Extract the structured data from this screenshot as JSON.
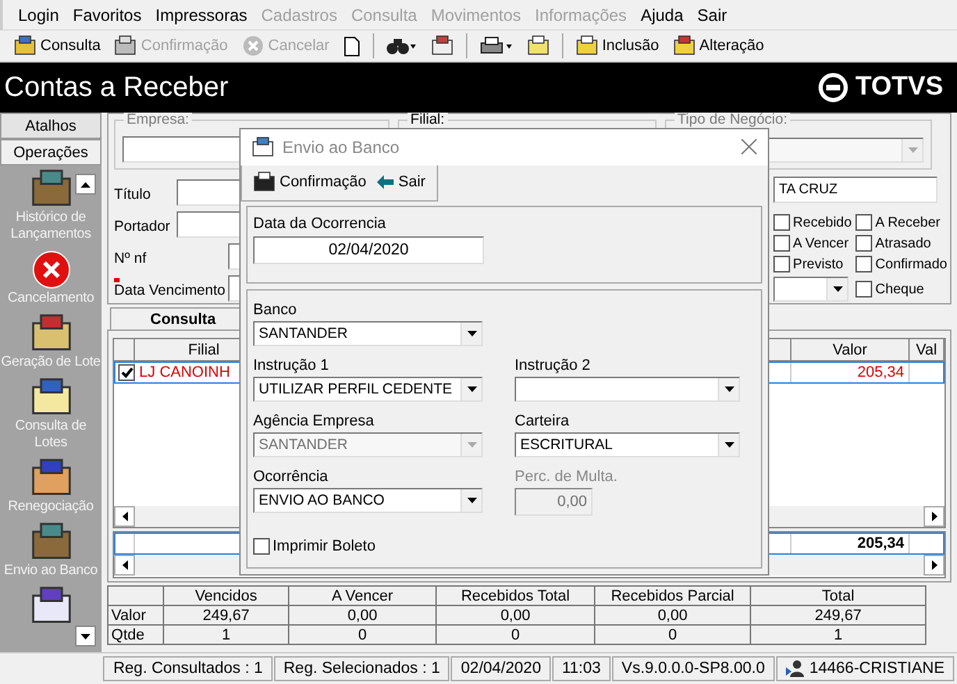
{
  "menu": [
    {
      "label": "Login",
      "disabled": false
    },
    {
      "label": "Favoritos",
      "disabled": false
    },
    {
      "label": "Impressoras",
      "disabled": false
    },
    {
      "label": "Cadastros",
      "disabled": true
    },
    {
      "label": "Consulta",
      "disabled": true
    },
    {
      "label": "Movimentos",
      "disabled": true
    },
    {
      "label": "Informações",
      "disabled": true
    },
    {
      "label": "Ajuda",
      "disabled": false
    },
    {
      "label": "Sair",
      "disabled": false
    }
  ],
  "toolbar": {
    "actions": [
      {
        "label": "Consulta",
        "disabled": false
      },
      {
        "label": "Confirmação",
        "disabled": true
      },
      {
        "label": "Cancelar",
        "disabled": true
      }
    ],
    "records": [
      {
        "label": "Inclusão",
        "disabled": false
      },
      {
        "label": "Alteração",
        "disabled": false
      }
    ]
  },
  "window": {
    "title": "Contas a Receber",
    "logo": "TOTVS"
  },
  "sidebar": {
    "tabs": [
      {
        "label": "Atalhos",
        "selected": false
      },
      {
        "label": "Operações",
        "selected": true
      }
    ],
    "items": [
      {
        "label": "Histórico de Lançamentos"
      },
      {
        "label": "Cancelamento"
      },
      {
        "label": "Geração de Lote"
      },
      {
        "label": "Consulta de Lotes"
      },
      {
        "label": "Renegociação"
      },
      {
        "label": "Envio ao Banco"
      }
    ]
  },
  "filters": {
    "groups": [
      {
        "legend": "Empresa:",
        "disabled": true
      },
      {
        "legend": "Filial:",
        "disabled": false
      },
      {
        "legend": "Tipo de Negócio:",
        "disabled": true
      }
    ],
    "fields": [
      {
        "label": "Título",
        "required": false
      },
      {
        "label": "Portador",
        "required": false
      },
      {
        "label": "Nº nf",
        "required": false
      },
      {
        "label": "Data Vencimento",
        "required": true
      }
    ],
    "name_value": "TA CRUZ",
    "status": [
      {
        "label": "Recebido",
        "checked": false
      },
      {
        "label": "A Receber",
        "checked": false
      },
      {
        "label": "A Vencer",
        "checked": false
      },
      {
        "label": "Atrasado",
        "checked": false
      },
      {
        "label": "Previsto",
        "checked": false
      },
      {
        "label": "Confirmado",
        "checked": false
      },
      {
        "label": "Cheque",
        "checked": false
      }
    ]
  },
  "results": {
    "tab": {
      "label": "Consulta",
      "selected": true
    },
    "columns": [
      "Filial",
      "Valor",
      "Val"
    ],
    "rows": [
      {
        "checked": true,
        "alert": true,
        "filial": "LJ CANOINH",
        "valor": "205,34"
      }
    ],
    "total": "205,34"
  },
  "summary": {
    "columns": [
      "Vencidos",
      "A Vencer",
      "Recebidos Total",
      "Recebidos Parcial",
      "Total"
    ],
    "rows": [
      {
        "label": "Valor",
        "values": [
          "249,67",
          "0,00",
          "0,00",
          "0,00",
          "249,67"
        ]
      },
      {
        "label": "Qtde",
        "values": [
          "1",
          "0",
          "0",
          "0",
          "1"
        ]
      }
    ]
  },
  "status_bar": [
    {
      "kind": "text",
      "text": "Reg. Consultados : 1"
    },
    {
      "kind": "text",
      "text": "Reg. Selecionados : 1"
    },
    {
      "kind": "text",
      "text": "02/04/2020"
    },
    {
      "kind": "text",
      "text": "11:03"
    },
    {
      "kind": "text",
      "text": "Vs.9.0.0.0-SP8.00.0"
    },
    {
      "kind": "user",
      "text": "14466-CRISTIANE"
    }
  ],
  "dialog": {
    "title": "Envio ao Banco",
    "buttons": [
      "Confirmação",
      "Sair"
    ],
    "date_label": "Data da Ocorrencia",
    "date_value": "02/04/2020",
    "rows": [
      [
        {
          "label": "Banco",
          "value": "SANTANDER",
          "kind": "select",
          "disabled": false
        }
      ],
      [
        {
          "label": "Instrução 1",
          "value": "UTILIZAR PERFIL CEDENTE",
          "kind": "select",
          "disabled": false
        },
        {
          "label": "Instrução 2",
          "kind": "select",
          "disabled": false
        }
      ],
      [
        {
          "label": "Agência Empresa",
          "value": "SANTANDER",
          "kind": "select",
          "disabled": true
        },
        {
          "label": "Carteira",
          "value": "ESCRITURAL",
          "kind": "select",
          "disabled": false
        }
      ],
      [
        {
          "label": "Ocorrência",
          "value": "ENVIO AO BANCO",
          "kind": "select",
          "disabled": false
        },
        {
          "label": "Perc. de Multa.",
          "value": "0,00",
          "kind": "number",
          "disabled": true
        }
      ]
    ],
    "print": {
      "label": "Imprimir Boleto",
      "checked": false
    }
  }
}
